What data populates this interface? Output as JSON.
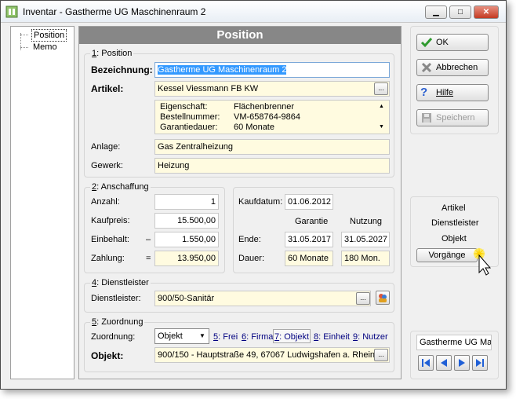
{
  "window": {
    "title": "Inventar - Gastherme UG Maschinenraum 2",
    "minimize": "▁",
    "maximize": "□",
    "close": "✕"
  },
  "tree": {
    "items": [
      "Position",
      "Memo"
    ]
  },
  "header": {
    "title": "Position"
  },
  "position_group": {
    "number": "1",
    "title": ": Position",
    "bezeichnung_label": "Bezeichnung:",
    "bezeichnung_value": "Gastherme UG Maschinenraum 2",
    "artikel_label": "Artikel:",
    "artikel_value": "Kessel Viessmann FB KW",
    "details": [
      {
        "key": "Eigenschaft:",
        "value": "Flächenbrenner"
      },
      {
        "key": "Bestellnummer:",
        "value": "VM-658764-9864"
      },
      {
        "key": "Garantiedauer:",
        "value": "60 Monate"
      }
    ],
    "anlage_label": "Anlage:",
    "anlage_value": "Gas Zentralheizung",
    "gewerk_label": "Gewerk:",
    "gewerk_value": "Heizung"
  },
  "anschaffung_group": {
    "number": "2",
    "title": ": Anschaffung",
    "anzahl_label": "Anzahl:",
    "anzahl_value": "1",
    "kaufpreis_label": "Kaufpreis:",
    "kaufpreis_value": "15.500,00",
    "einbehalt_label": "Einbehalt:",
    "einbehalt_op": "–",
    "einbehalt_value": "1.550,00",
    "zahlung_label": "Zahlung:",
    "zahlung_op": "=",
    "zahlung_value": "13.950,00",
    "kaufdatum_label": "Kaufdatum:",
    "kaufdatum_value": "01.06.2012",
    "col_garantie": "Garantie",
    "col_nutzung": "Nutzung",
    "ende_label": "Ende:",
    "ende_garantie": "31.05.2017",
    "ende_nutzung": "31.05.2027",
    "dauer_label": "Dauer:",
    "dauer_garantie": "60 Monate",
    "dauer_nutzung": "180 Mon."
  },
  "dienstleister_group": {
    "number": "4",
    "title": ": Dienstleister",
    "label": "Dienstleister:",
    "value": "900/50-Sanitär"
  },
  "zuordnung_group": {
    "number": "5",
    "title": ": Zuordnung",
    "label": "Zuordnung:",
    "select_value": "Objekt",
    "tabs": [
      {
        "num": "5",
        "label": ": Frei"
      },
      {
        "num": "6",
        "label": ": Firma"
      },
      {
        "num": "7",
        "label": ": Objekt"
      },
      {
        "num": "8",
        "label": ": Einheit"
      },
      {
        "num": "9",
        "label": ": Nutzer"
      }
    ],
    "objekt_label": "Objekt:",
    "objekt_value": "900/150 - Hauptstraße 49, 67067 Ludwigshafen a. Rhein",
    "ellipsis": "..."
  },
  "buttons": {
    "ok": "OK",
    "abbrechen": "Abbrechen",
    "hilfe": "Hilfe",
    "speichern": "Speichern"
  },
  "links_panel": {
    "items": [
      "Artikel",
      "Dienstleister",
      "Objekt"
    ],
    "button": "Vorgänge"
  },
  "record_panel": {
    "current": "Gastherme UG Ma"
  },
  "colors": {
    "header_band": "#878787",
    "field_yellow": "#fffbe0",
    "selection": "#3399ff",
    "nav_blue": "#1f5fd6"
  }
}
